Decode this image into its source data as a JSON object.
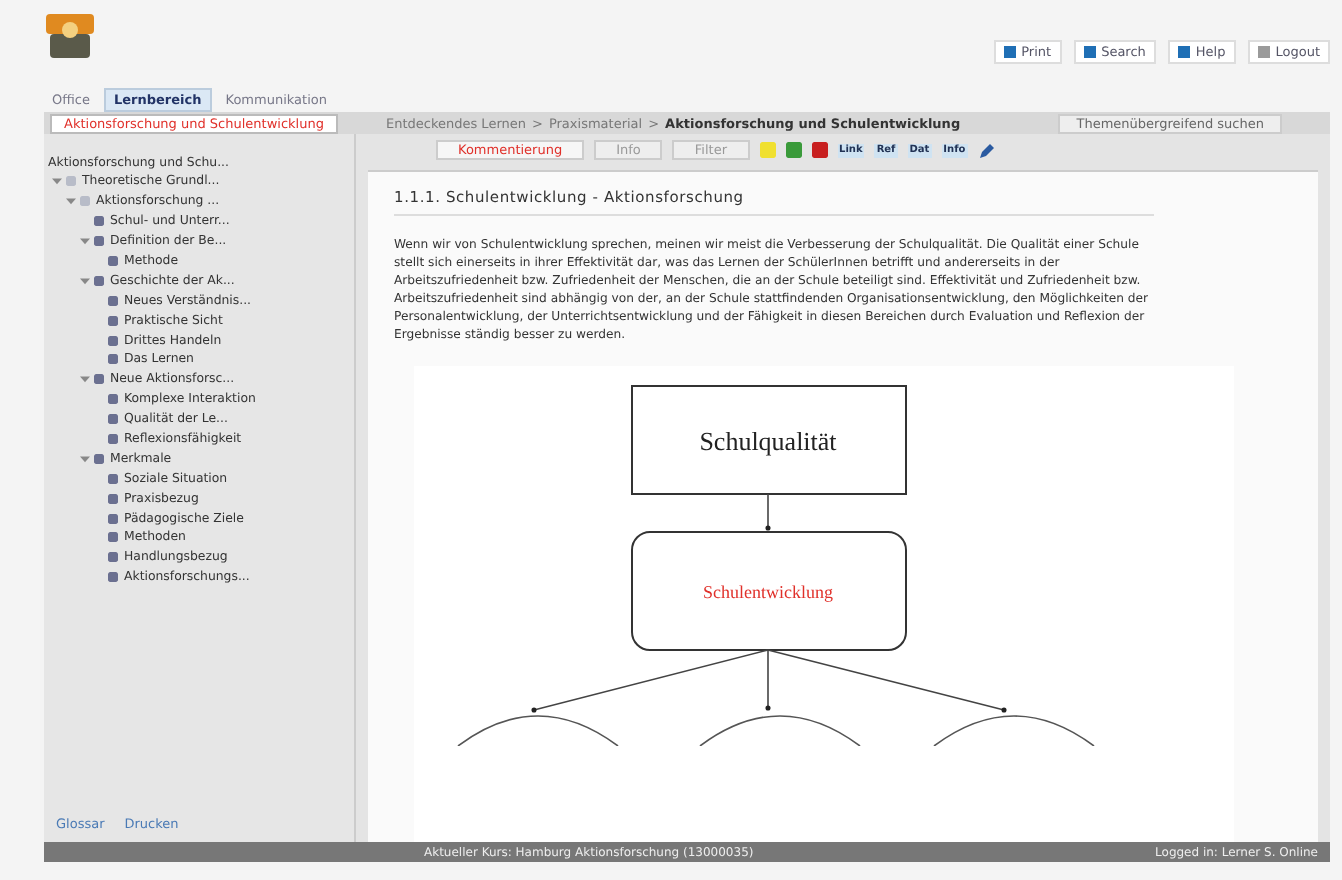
{
  "header": {
    "buttons": [
      {
        "label": "Print",
        "color": "#1f6fb5"
      },
      {
        "label": "Search",
        "color": "#1f6fb5"
      },
      {
        "label": "Help",
        "color": "#1f6fb5"
      },
      {
        "label": "Logout",
        "color": "#9a9a9a"
      }
    ]
  },
  "tabs": [
    {
      "label": "Office",
      "selected": false
    },
    {
      "label": "Lernbereich",
      "selected": true
    },
    {
      "label": "Kommunikation",
      "selected": false
    }
  ],
  "panel_tab": {
    "label": "Aktionsforschung und Schulentwicklung",
    "selected": true
  },
  "breadcrumb_separator": ">",
  "breadcrumb": [
    {
      "label": "Entdeckendes Lernen",
      "current": false
    },
    {
      "label": "Praxismaterial",
      "current": false
    },
    {
      "label": "Aktionsforschung und Schulentwicklung",
      "current": true
    }
  ],
  "side_tab": {
    "label": "Themenübergreifend suchen"
  },
  "toolbar": {
    "buttons": [
      {
        "label": "Kommentierung",
        "selected": true
      },
      {
        "label": "Info",
        "selected": false
      },
      {
        "label": "Filter",
        "selected": false
      }
    ],
    "markers": [
      {
        "color": "#f0e030"
      },
      {
        "color": "#3a9a3a"
      },
      {
        "color": "#c82020"
      }
    ],
    "tools": [
      "Link",
      "Ref",
      "Dat",
      "Info"
    ]
  },
  "tree": {
    "title": "Aktionsforschung und Schu...",
    "items": [
      {
        "label": "Theoretische Grundl...",
        "expanded": true,
        "children": [
          {
            "label": "Aktionsforschung ...",
            "expanded": true,
            "children": [
              {
                "label": "Schul- und Unterr..."
              },
              {
                "label": "Definition der Be...",
                "expanded": true,
                "children": [
                  {
                    "label": "Methode"
                  }
                ]
              },
              {
                "label": "Geschichte der Ak...",
                "expanded": true,
                "children": [
                  {
                    "label": "Neues Verständnis..."
                  },
                  {
                    "label": "Praktische Sicht"
                  },
                  {
                    "label": "Drittes Handeln"
                  },
                  {
                    "label": "Das Lernen"
                  }
                ]
              },
              {
                "label": "Neue Aktionsforsc...",
                "expanded": true,
                "children": [
                  {
                    "label": "Komplexe Interaktion"
                  },
                  {
                    "label": "Qualität der Le..."
                  },
                  {
                    "label": "Reflexionsfähigkeit"
                  }
                ]
              },
              {
                "label": "Merkmale",
                "expanded": true,
                "children": [
                  {
                    "label": "Soziale Situation"
                  },
                  {
                    "label": "Praxisbezug"
                  },
                  {
                    "label": "Pädagogische Ziele"
                  },
                  {
                    "label": "Methoden"
                  },
                  {
                    "label": "Handlungsbezug"
                  },
                  {
                    "label": "Aktionsforschungs..."
                  }
                ]
              }
            ]
          }
        ]
      }
    ]
  },
  "sidebar_links": [
    "Glossar",
    "Drucken"
  ],
  "content": {
    "title": "1.1.1. Schulentwicklung - Aktionsforschung",
    "paragraph": "Wenn wir von Schulentwicklung sprechen, meinen wir meist die Verbesserung der Schulqualität. Die Qualität einer Schule stellt sich einerseits in ihrer Effektivität dar, was das Lernen der SchülerInnen betrifft und andererseits in der Arbeitszufriedenheit bzw. Zufriedenheit der Menschen, die an der Schule beteiligt sind. Effektivität und Zufriedenheit bzw. Arbeitszufriedenheit sind abhängig von der, an der Schule stattfindenden Organisationsentwicklung, den Möglichkeiten der Personalentwicklung, der Unterrichtsentwicklung und der Fähigkeit in diesen Bereichen durch Evaluation und Reflexion der Ergebnisse ständig besser zu werden.",
    "diagram": {
      "top": "Schulqualität",
      "middle": "Schulentwicklung"
    }
  },
  "status_bar": {
    "left": "Aktueller Kurs: Hamburg Aktionsforschung (13000035)",
    "right": "Logged in: Lerner S. Online"
  }
}
